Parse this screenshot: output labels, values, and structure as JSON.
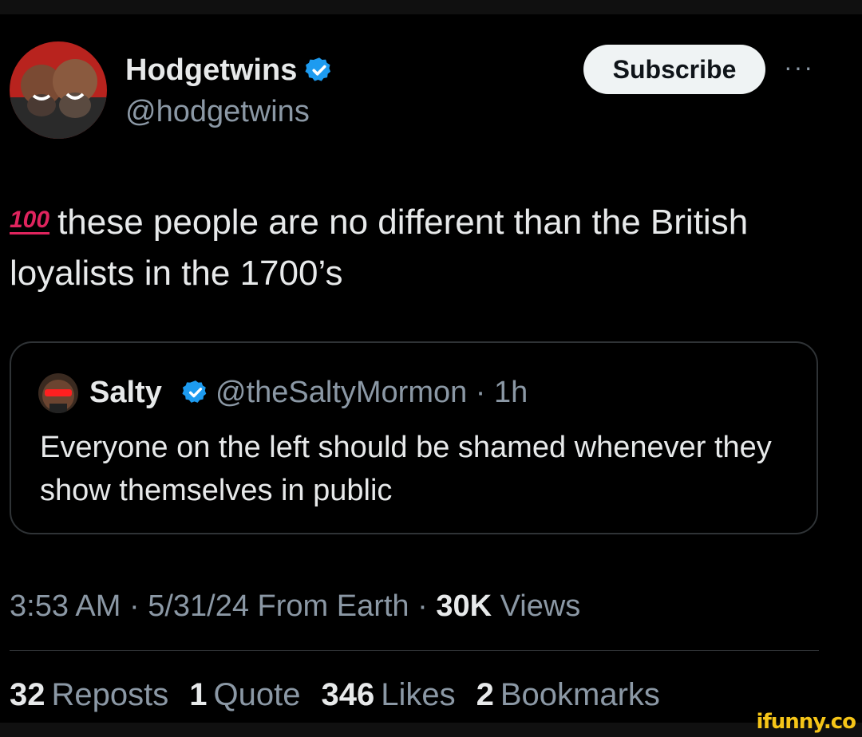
{
  "author": {
    "display_name": "Hodgetwins",
    "handle": "@hodgetwins",
    "avatar_icon": "avatar-photo",
    "verified_icon": "verified-badge-icon"
  },
  "actions": {
    "subscribe_label": "Subscribe",
    "more_label": "···"
  },
  "tweet": {
    "emoji": "100",
    "text": "these people are no different than the British loyalists in the 1700’s"
  },
  "quoted_tweet": {
    "display_name": "Salty",
    "handle_time": "@theSaltyMormon · 1h",
    "text": "Everyone on the left should be shamed whenever they show themselves in public"
  },
  "meta": {
    "time_date": "3:53 AM · 5/31/24 From Earth · ",
    "views_count": "30K",
    "views_label": " Views"
  },
  "stats": [
    {
      "count": "32",
      "label": "Reposts"
    },
    {
      "count": "1",
      "label": "Quote"
    },
    {
      "count": "346",
      "label": "Likes"
    },
    {
      "count": "2",
      "label": "Bookmarks"
    }
  ],
  "watermark": "ifunny.co",
  "colors": {
    "background": "#000000",
    "text_primary": "#e7e9ea",
    "text_secondary": "#8b98a5",
    "verified_blue": "#1d9bf0",
    "border": "#2f3336",
    "emoji_red": "#e0245e"
  }
}
